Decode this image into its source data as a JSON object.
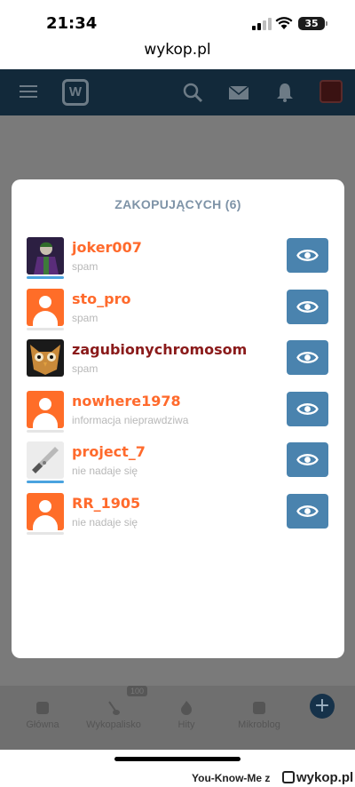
{
  "status": {
    "time": "21:34",
    "battery": "35"
  },
  "browser": {
    "url": "wykop.pl"
  },
  "nav": {
    "items": [
      "Główna",
      "Wykopalisko",
      "Hity",
      "Mikroblog"
    ],
    "badge": "100",
    "fab": "+"
  },
  "modal": {
    "title": "ZAKOPUJĄCYCH (6)",
    "users": [
      {
        "name": "joker007",
        "reason": "spam",
        "name_color": "#ff6a2c",
        "underline_color": "#4aa3df"
      },
      {
        "name": "sto_pro",
        "reason": "spam",
        "name_color": "#ff6a2c",
        "underline_color": "#e5e5e5"
      },
      {
        "name": "zagubionychromosom",
        "reason": "spam",
        "name_color": "#8a1a1a",
        "underline_color": "#e5e5e5"
      },
      {
        "name": "nowhere1978",
        "reason": "informacja nieprawdziwa",
        "name_color": "#ff6a2c",
        "underline_color": "#e5e5e5"
      },
      {
        "name": "project_7",
        "reason": "nie nadaje się",
        "name_color": "#ff6a2c",
        "underline_color": "#4aa3df"
      },
      {
        "name": "RR_1905",
        "reason": "nie nadaje się",
        "name_color": "#ff6a2c",
        "underline_color": "#e5e5e5"
      }
    ]
  },
  "credit": {
    "user": "You-Know-Me z",
    "brand": "wykop.pl"
  },
  "colors": {
    "accent_orange": "#ff6a2c",
    "button_blue": "#4a83ae",
    "header_navy": "#12293a"
  }
}
